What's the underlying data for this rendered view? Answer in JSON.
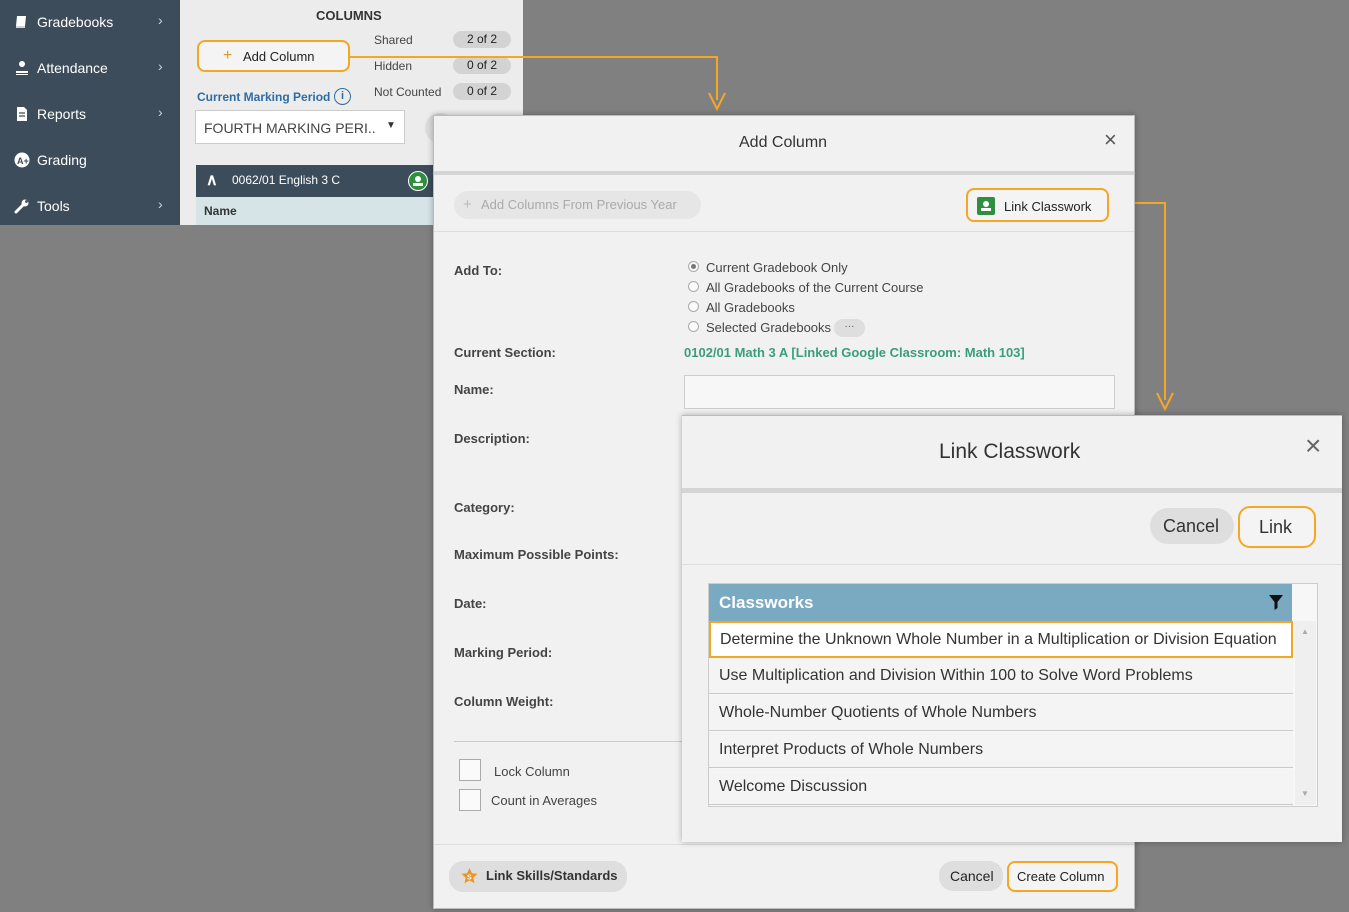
{
  "sidebar": {
    "items": [
      {
        "label": "Gradebooks",
        "icon": "book-icon",
        "chevron": true
      },
      {
        "label": "Attendance",
        "icon": "user-check-icon",
        "chevron": true
      },
      {
        "label": "Reports",
        "icon": "document-icon",
        "chevron": true
      },
      {
        "label": "Grading",
        "icon": "a-plus-icon",
        "chevron": false
      },
      {
        "label": "Tools",
        "icon": "wrench-icon",
        "chevron": true
      }
    ]
  },
  "columns_panel": {
    "title": "COLUMNS",
    "add_column_label": "Add Column",
    "stats": [
      {
        "label": "Shared",
        "value": "2 of 2"
      },
      {
        "label": "Hidden",
        "value": "0 of 2"
      },
      {
        "label": "Not Counted",
        "value": "0 of 2"
      }
    ],
    "marking_period_label": "Current Marking Period",
    "marking_period_value": "FOURTH MARKING PERI..",
    "section_name": "0062/01 English 3 C",
    "name_header": "Name"
  },
  "add_column_modal": {
    "title": "Add Column",
    "prev_year_button": "Add Columns From Previous Year",
    "link_classwork_button": "Link Classwork",
    "add_to_label": "Add To:",
    "add_to_options": [
      {
        "label": "Current Gradebook Only",
        "selected": true
      },
      {
        "label": "All Gradebooks of the Current Course",
        "selected": false
      },
      {
        "label": "All Gradebooks",
        "selected": false
      },
      {
        "label": "Selected Gradebooks",
        "selected": false
      }
    ],
    "selected_gradebooks_more": "···",
    "current_section_label": "Current Section:",
    "current_section_value": "0102/01 Math 3 A [Linked Google Classroom: Math 103]",
    "name_label": "Name:",
    "description_label": "Description:",
    "category_label": "Category:",
    "max_points_label": "Maximum Possible Points:",
    "date_label": "Date:",
    "marking_period_label": "Marking Period:",
    "column_weight_label": "Column Weight:",
    "lock_column_label": "Lock Column",
    "count_in_averages_label": "Count in Averages",
    "link_skills_button": "Link Skills/Standards",
    "cancel_button": "Cancel",
    "create_button": "Create Column"
  },
  "link_classwork_dialog": {
    "title": "Link Classwork",
    "cancel_button": "Cancel",
    "link_button": "Link",
    "table_header": "Classworks",
    "rows": [
      "Determine the Unknown Whole Number in a Multiplication or Division Equation",
      "Use Multiplication and Division Within 100 to Solve Word Problems",
      "Whole-Number Quotients of Whole Numbers",
      "Interpret Products of Whole Numbers",
      "Welcome Discussion"
    ],
    "selected_row_index": 0
  },
  "colors": {
    "highlight": "#f5a623",
    "sidebar_bg": "#3d4c5b",
    "link_blue": "#2e6da4",
    "section_green": "#3a9e7c",
    "table_header_bg": "#7aa9c2",
    "classroom_green": "#2f8f3e"
  }
}
